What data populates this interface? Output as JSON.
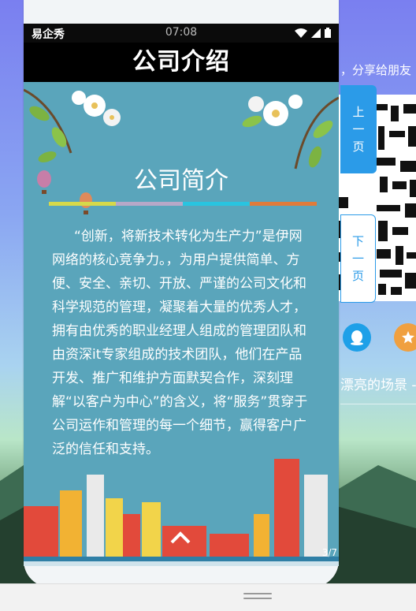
{
  "status_bar": {
    "carrier": "易企秀",
    "time": "07:08"
  },
  "page_title": "公司介绍",
  "content": {
    "heading": "公司简介",
    "paragraph": "“创新，将新技术转化为生产力”是伊网网络的核心竞争力。，为用户提供简单、方便、安全、亲切、开放、严谨的公司文化和科学规范的管理，凝聚着大量的优秀人才，拥有由优秀的职业经理人组成的管理团队和由资深it专家组成的技术团队，他们在产品开发、推广和维护方面默契合作，深刻理解“以客户为中心”的含义，将“服务”贯穿于公司运作和管理的每一个细节，赢得客户广泛的信任和支持。",
    "page_indicator": "3/7",
    "color_bar": [
      "#d7d94a",
      "#b7a8c8",
      "#29c4e0",
      "#e07b3a"
    ]
  },
  "side_panel": {
    "share_text": "，分享给朋友",
    "prev_label": [
      "上",
      "一",
      "页"
    ],
    "next_label": [
      "下",
      "一",
      "页"
    ],
    "scene_text": "漂亮的场景 -"
  },
  "colors": {
    "accent": "#2b9be8",
    "screen_bg": "#5aa5bb",
    "qq": "#1ea0e8",
    "star": "#f0a040"
  },
  "icons": [
    "wifi-icon",
    "signal-icon",
    "battery-icon",
    "qq-icon",
    "star-icon",
    "up-arrow-icon",
    "qr-code"
  ]
}
